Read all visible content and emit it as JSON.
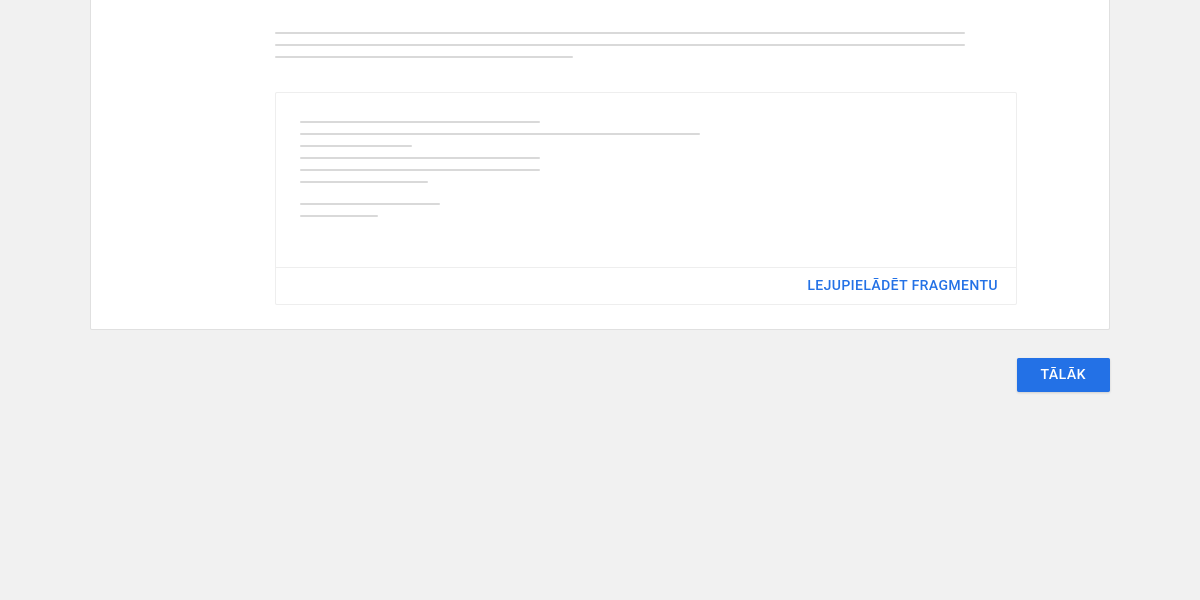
{
  "codeCard": {
    "downloadLabel": "LEJUPIELĀDĒT FRAGMENTU"
  },
  "footer": {
    "nextLabel": "TĀLĀK"
  },
  "placeholders": {
    "description_lines": [
      690,
      690,
      298
    ],
    "code_lines": [
      240,
      400,
      112,
      240,
      240,
      128,
      0,
      140,
      78
    ]
  }
}
